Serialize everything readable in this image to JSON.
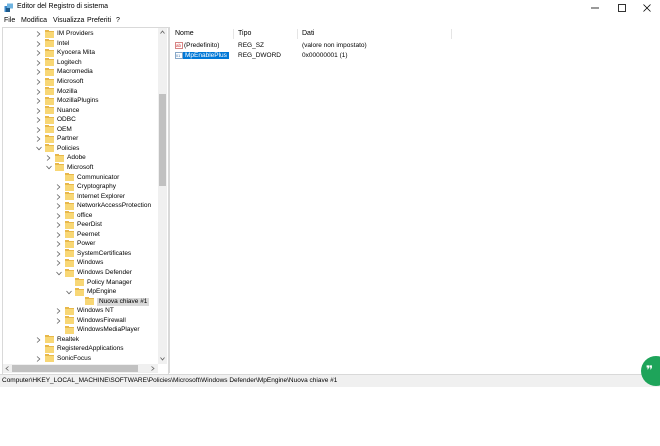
{
  "window": {
    "title": "Editor del Registro di sistema",
    "controls": {
      "minimize": "—",
      "maximize": "☐",
      "close": "✕"
    }
  },
  "menu": [
    "File",
    "Modifica",
    "Visualizza",
    "Preferiti",
    "?"
  ],
  "tree": {
    "items": [
      {
        "label": "IM Providers",
        "depth": 0,
        "expand": "collapsed"
      },
      {
        "label": "Intel",
        "depth": 0,
        "expand": "collapsed"
      },
      {
        "label": "Kyocera Mita",
        "depth": 0,
        "expand": "collapsed"
      },
      {
        "label": "Logitech",
        "depth": 0,
        "expand": "collapsed"
      },
      {
        "label": "Macromedia",
        "depth": 0,
        "expand": "collapsed"
      },
      {
        "label": "Microsoft",
        "depth": 0,
        "expand": "collapsed"
      },
      {
        "label": "Mozilla",
        "depth": 0,
        "expand": "collapsed"
      },
      {
        "label": "MozillaPlugins",
        "depth": 0,
        "expand": "collapsed"
      },
      {
        "label": "Nuance",
        "depth": 0,
        "expand": "collapsed"
      },
      {
        "label": "ODBC",
        "depth": 0,
        "expand": "collapsed"
      },
      {
        "label": "OEM",
        "depth": 0,
        "expand": "collapsed"
      },
      {
        "label": "Partner",
        "depth": 0,
        "expand": "collapsed"
      },
      {
        "label": "Policies",
        "depth": 0,
        "expand": "expanded"
      },
      {
        "label": "Adobe",
        "depth": 1,
        "expand": "collapsed"
      },
      {
        "label": "Microsoft",
        "depth": 1,
        "expand": "expanded"
      },
      {
        "label": "Communicator",
        "depth": 2,
        "expand": "none"
      },
      {
        "label": "Cryptography",
        "depth": 2,
        "expand": "collapsed"
      },
      {
        "label": "Internet Explorer",
        "depth": 2,
        "expand": "collapsed"
      },
      {
        "label": "NetworkAccessProtection",
        "depth": 2,
        "expand": "collapsed"
      },
      {
        "label": "office",
        "depth": 2,
        "expand": "collapsed"
      },
      {
        "label": "PeerDist",
        "depth": 2,
        "expand": "collapsed"
      },
      {
        "label": "Peernet",
        "depth": 2,
        "expand": "collapsed"
      },
      {
        "label": "Power",
        "depth": 2,
        "expand": "collapsed"
      },
      {
        "label": "SystemCertificates",
        "depth": 2,
        "expand": "collapsed"
      },
      {
        "label": "Windows",
        "depth": 2,
        "expand": "collapsed"
      },
      {
        "label": "Windows Defender",
        "depth": 2,
        "expand": "expanded"
      },
      {
        "label": "Policy Manager",
        "depth": 3,
        "expand": "none"
      },
      {
        "label": "MpEngine",
        "depth": 3,
        "expand": "expanded"
      },
      {
        "label": "Nuova chiave #1",
        "depth": 4,
        "expand": "none",
        "selected": true
      },
      {
        "label": "Windows NT",
        "depth": 2,
        "expand": "collapsed"
      },
      {
        "label": "WindowsFirewall",
        "depth": 2,
        "expand": "collapsed"
      },
      {
        "label": "WindowsMediaPlayer",
        "depth": 2,
        "expand": "none"
      },
      {
        "label": "Realtek",
        "depth": 0,
        "expand": "collapsed"
      },
      {
        "label": "RegisteredApplications",
        "depth": 0,
        "expand": "none"
      },
      {
        "label": "SonicFocus",
        "depth": 0,
        "expand": "collapsed"
      }
    ]
  },
  "list": {
    "columns": [
      "Nome",
      "Tipo",
      "Dati"
    ],
    "rows": [
      {
        "name": "(Predefinito)",
        "type": "REG_SZ",
        "data": "(valore non impostato)",
        "icon": "string-value-icon",
        "selected": false
      },
      {
        "name": "MpEnablePlus",
        "type": "REG_DWORD",
        "data": "0x00000001 (1)",
        "icon": "binary-value-icon",
        "selected": true
      }
    ]
  },
  "status": {
    "path": "Computer\\HKEY_LOCAL_MACHINE\\SOFTWARE\\Policies\\Microsoft\\Windows Defender\\MpEngine\\Nuova chiave #1"
  },
  "fab": {
    "glyph": "❞",
    "icon": "quote-icon"
  },
  "colors": {
    "accent": "#0078d7",
    "folder": "#f8d775",
    "fab": "#1ea45a"
  }
}
